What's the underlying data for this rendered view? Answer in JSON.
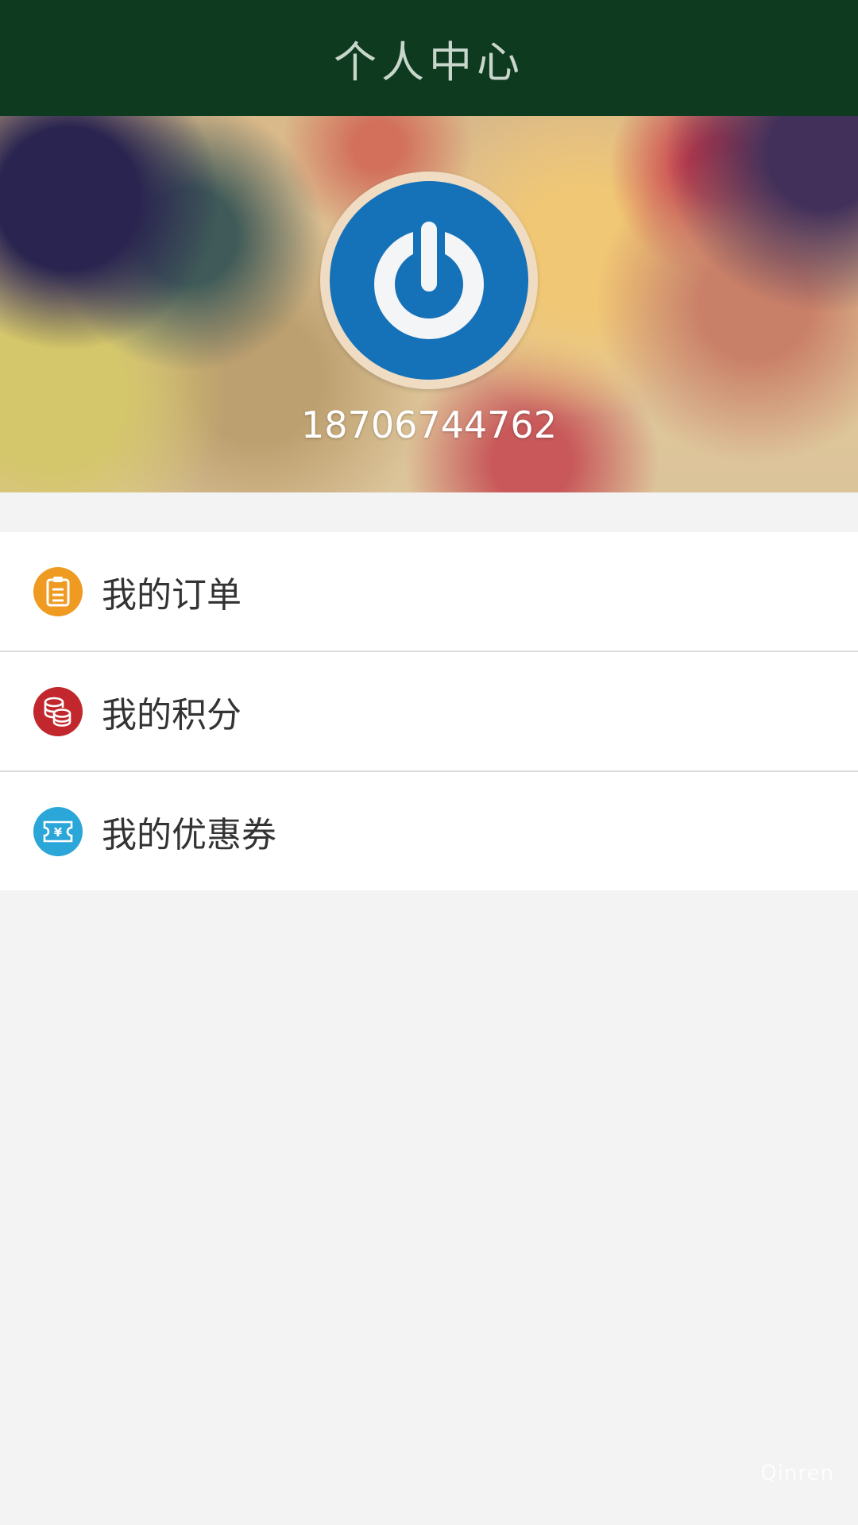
{
  "header": {
    "title": "个人中心",
    "background_color": "#0e3b1f"
  },
  "profile": {
    "avatar_icon": "power-logo-icon",
    "avatar_color": "#1672b8",
    "phone": "18706744762"
  },
  "menu": {
    "items": [
      {
        "label": "我的订单",
        "icon": "clipboard-icon",
        "icon_color": "#ef9a21"
      },
      {
        "label": "我的积分",
        "icon": "coins-icon",
        "icon_color": "#c1272d"
      },
      {
        "label": "我的优惠券",
        "icon": "coupon-icon",
        "icon_color": "#2ba6d8"
      }
    ]
  },
  "watermark": {
    "text": "Qinren"
  }
}
